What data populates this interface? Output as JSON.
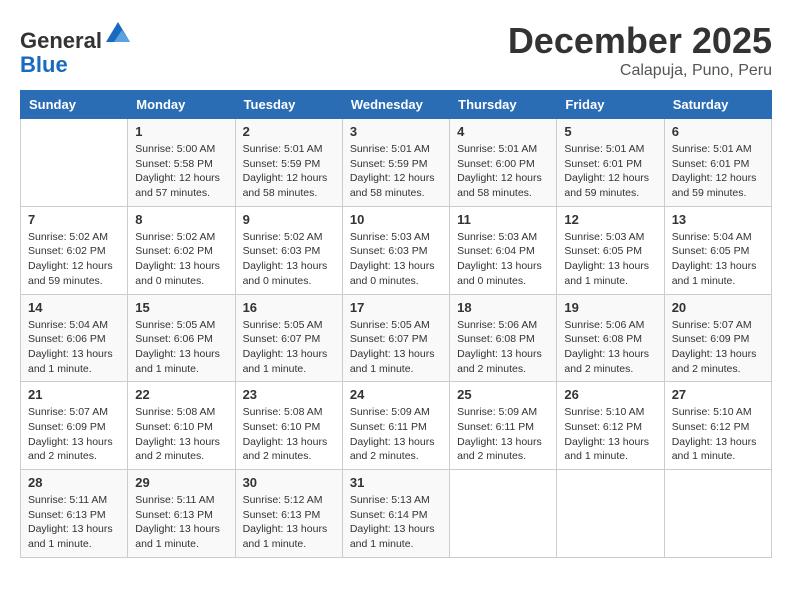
{
  "logo": {
    "general": "General",
    "blue": "Blue"
  },
  "title": "December 2025",
  "location": "Calapuja, Puno, Peru",
  "days_of_week": [
    "Sunday",
    "Monday",
    "Tuesday",
    "Wednesday",
    "Thursday",
    "Friday",
    "Saturday"
  ],
  "weeks": [
    [
      {
        "day": "",
        "info": ""
      },
      {
        "day": "1",
        "info": "Sunrise: 5:00 AM\nSunset: 5:58 PM\nDaylight: 12 hours\nand 57 minutes."
      },
      {
        "day": "2",
        "info": "Sunrise: 5:01 AM\nSunset: 5:59 PM\nDaylight: 12 hours\nand 58 minutes."
      },
      {
        "day": "3",
        "info": "Sunrise: 5:01 AM\nSunset: 5:59 PM\nDaylight: 12 hours\nand 58 minutes."
      },
      {
        "day": "4",
        "info": "Sunrise: 5:01 AM\nSunset: 6:00 PM\nDaylight: 12 hours\nand 58 minutes."
      },
      {
        "day": "5",
        "info": "Sunrise: 5:01 AM\nSunset: 6:01 PM\nDaylight: 12 hours\nand 59 minutes."
      },
      {
        "day": "6",
        "info": "Sunrise: 5:01 AM\nSunset: 6:01 PM\nDaylight: 12 hours\nand 59 minutes."
      }
    ],
    [
      {
        "day": "7",
        "info": "Sunrise: 5:02 AM\nSunset: 6:02 PM\nDaylight: 12 hours\nand 59 minutes."
      },
      {
        "day": "8",
        "info": "Sunrise: 5:02 AM\nSunset: 6:02 PM\nDaylight: 13 hours\nand 0 minutes."
      },
      {
        "day": "9",
        "info": "Sunrise: 5:02 AM\nSunset: 6:03 PM\nDaylight: 13 hours\nand 0 minutes."
      },
      {
        "day": "10",
        "info": "Sunrise: 5:03 AM\nSunset: 6:03 PM\nDaylight: 13 hours\nand 0 minutes."
      },
      {
        "day": "11",
        "info": "Sunrise: 5:03 AM\nSunset: 6:04 PM\nDaylight: 13 hours\nand 0 minutes."
      },
      {
        "day": "12",
        "info": "Sunrise: 5:03 AM\nSunset: 6:05 PM\nDaylight: 13 hours\nand 1 minute."
      },
      {
        "day": "13",
        "info": "Sunrise: 5:04 AM\nSunset: 6:05 PM\nDaylight: 13 hours\nand 1 minute."
      }
    ],
    [
      {
        "day": "14",
        "info": "Sunrise: 5:04 AM\nSunset: 6:06 PM\nDaylight: 13 hours\nand 1 minute."
      },
      {
        "day": "15",
        "info": "Sunrise: 5:05 AM\nSunset: 6:06 PM\nDaylight: 13 hours\nand 1 minute."
      },
      {
        "day": "16",
        "info": "Sunrise: 5:05 AM\nSunset: 6:07 PM\nDaylight: 13 hours\nand 1 minute."
      },
      {
        "day": "17",
        "info": "Sunrise: 5:05 AM\nSunset: 6:07 PM\nDaylight: 13 hours\nand 1 minute."
      },
      {
        "day": "18",
        "info": "Sunrise: 5:06 AM\nSunset: 6:08 PM\nDaylight: 13 hours\nand 2 minutes."
      },
      {
        "day": "19",
        "info": "Sunrise: 5:06 AM\nSunset: 6:08 PM\nDaylight: 13 hours\nand 2 minutes."
      },
      {
        "day": "20",
        "info": "Sunrise: 5:07 AM\nSunset: 6:09 PM\nDaylight: 13 hours\nand 2 minutes."
      }
    ],
    [
      {
        "day": "21",
        "info": "Sunrise: 5:07 AM\nSunset: 6:09 PM\nDaylight: 13 hours\nand 2 minutes."
      },
      {
        "day": "22",
        "info": "Sunrise: 5:08 AM\nSunset: 6:10 PM\nDaylight: 13 hours\nand 2 minutes."
      },
      {
        "day": "23",
        "info": "Sunrise: 5:08 AM\nSunset: 6:10 PM\nDaylight: 13 hours\nand 2 minutes."
      },
      {
        "day": "24",
        "info": "Sunrise: 5:09 AM\nSunset: 6:11 PM\nDaylight: 13 hours\nand 2 minutes."
      },
      {
        "day": "25",
        "info": "Sunrise: 5:09 AM\nSunset: 6:11 PM\nDaylight: 13 hours\nand 2 minutes."
      },
      {
        "day": "26",
        "info": "Sunrise: 5:10 AM\nSunset: 6:12 PM\nDaylight: 13 hours\nand 1 minute."
      },
      {
        "day": "27",
        "info": "Sunrise: 5:10 AM\nSunset: 6:12 PM\nDaylight: 13 hours\nand 1 minute."
      }
    ],
    [
      {
        "day": "28",
        "info": "Sunrise: 5:11 AM\nSunset: 6:13 PM\nDaylight: 13 hours\nand 1 minute."
      },
      {
        "day": "29",
        "info": "Sunrise: 5:11 AM\nSunset: 6:13 PM\nDaylight: 13 hours\nand 1 minute."
      },
      {
        "day": "30",
        "info": "Sunrise: 5:12 AM\nSunset: 6:13 PM\nDaylight: 13 hours\nand 1 minute."
      },
      {
        "day": "31",
        "info": "Sunrise: 5:13 AM\nSunset: 6:14 PM\nDaylight: 13 hours\nand 1 minute."
      },
      {
        "day": "",
        "info": ""
      },
      {
        "day": "",
        "info": ""
      },
      {
        "day": "",
        "info": ""
      }
    ]
  ]
}
